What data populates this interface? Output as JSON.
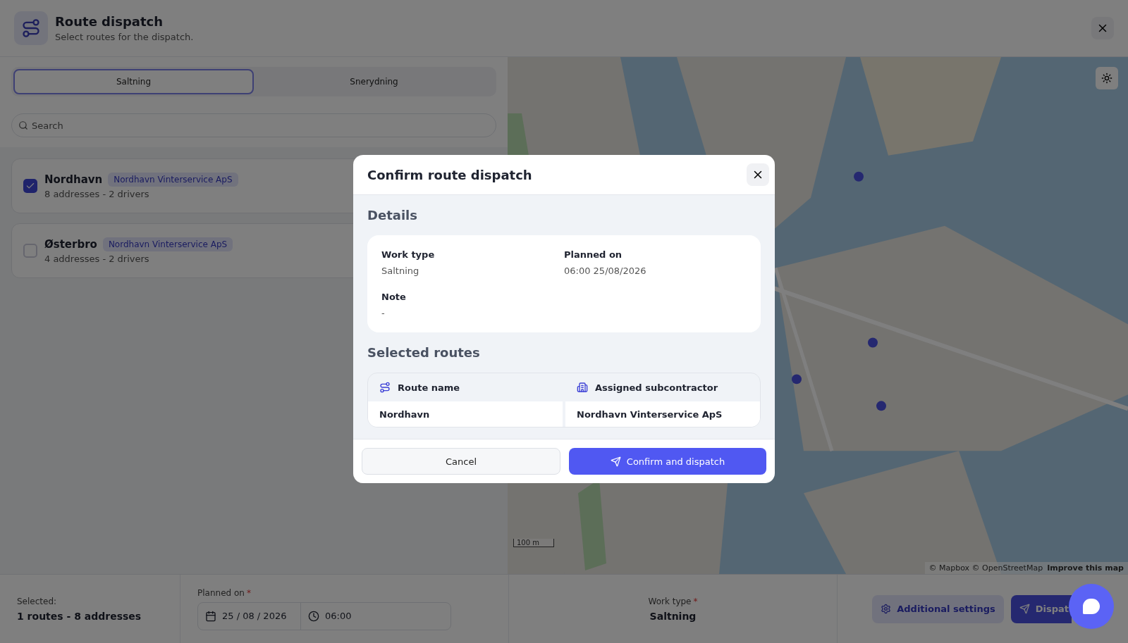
{
  "header": {
    "title": "Route dispatch",
    "subtitle": "Select routes for the dispatch."
  },
  "tabs": [
    {
      "label": "Saltning",
      "selected": true
    },
    {
      "label": "Snerydning",
      "selected": false
    }
  ],
  "search": {
    "placeholder": "Search"
  },
  "routes": [
    {
      "name": "Nordhavn",
      "subcontractor": "Nordhavn Vinterservice ApS",
      "summary": "8 addresses - 2 drivers",
      "checked": true
    },
    {
      "name": "Østerbro",
      "subcontractor": "Nordhavn Vinterservice ApS",
      "summary": "4 addresses - 2 drivers",
      "checked": false
    }
  ],
  "map": {
    "scale": "100 m",
    "attribution": "© Mapbox © OpenStreetMap",
    "improve_link": "Improve this map"
  },
  "bottom_bar": {
    "selected_label": "Selected:",
    "selected_value": "1 routes - 8 addresses",
    "planned_label": "Planned on",
    "required_mark": "*",
    "date": "25 / 08 / 2026",
    "time": "06:00",
    "work_type_label": "Work type",
    "work_type": "Saltning",
    "settings_button": "Additional settings",
    "dispatch_button": "Dispat"
  },
  "dialog": {
    "title": "Confirm route dispatch",
    "details_heading": "Details",
    "fields": [
      {
        "label": "Work type",
        "value": "Saltning"
      },
      {
        "label": "Planned on",
        "value": "06:00 25/08/2026"
      },
      {
        "label": "Note",
        "value": "-"
      }
    ],
    "routes_heading": "Selected routes",
    "columns": [
      "Route name",
      "Assigned subcontractor"
    ],
    "rows": [
      [
        "Nordhavn",
        "Nordhavn Vinterservice ApS"
      ]
    ],
    "cancel_button": "Cancel",
    "confirm_button": "Confirm and dispatch"
  }
}
